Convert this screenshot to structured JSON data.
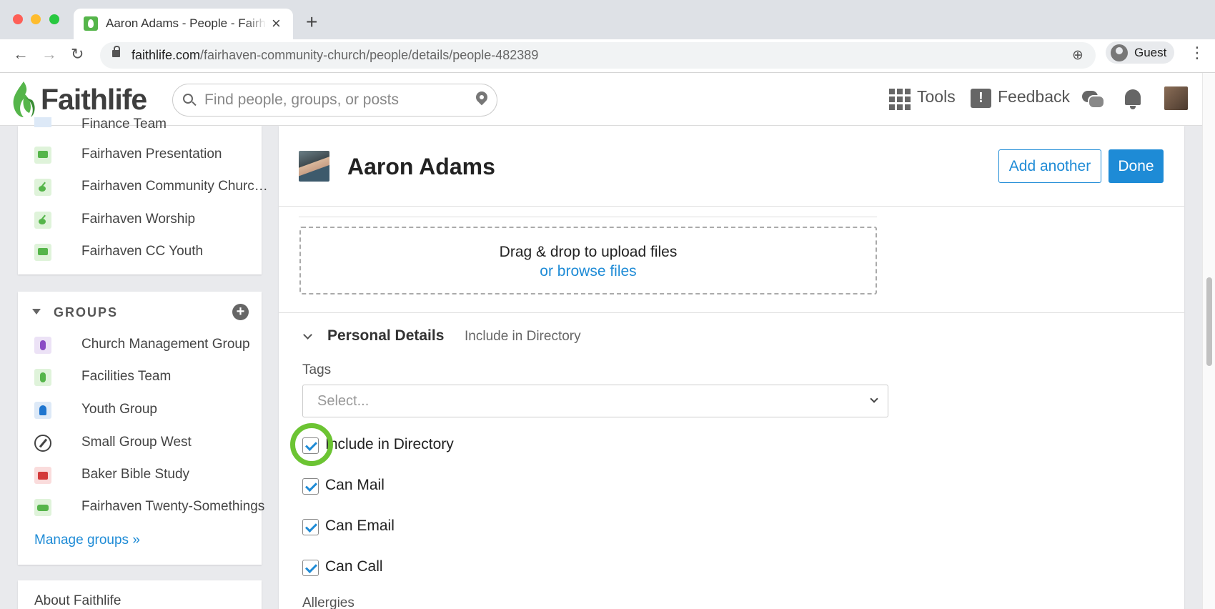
{
  "browser": {
    "tab_title": "Aaron Adams - People - Fairhaven",
    "new_tab_icon": "plus-icon",
    "url_domain": "faithlife.com",
    "url_path": "/fairhaven-community-church/people/details/people-482389",
    "profile_label": "Guest"
  },
  "header": {
    "logo_text": "Faithlife",
    "search_placeholder": "Find people, groups, or posts",
    "tools_label": "Tools",
    "feedback_label": "Feedback",
    "feedback_glyph": "!"
  },
  "sidebar": {
    "partial_item_label": "Finance Team",
    "top_items": [
      {
        "label": "Fairhaven Presentation",
        "icon": "chat-icon"
      },
      {
        "label": "Fairhaven Community Churc…",
        "icon": "guitar-icon"
      },
      {
        "label": "Fairhaven Worship",
        "icon": "guitar-icon"
      },
      {
        "label": "Fairhaven CC Youth",
        "icon": "chat-icon"
      }
    ],
    "groups_title": "GROUPS",
    "add_glyph": "+",
    "groups": [
      {
        "label": "Church Management Group",
        "icon": "people-icon"
      },
      {
        "label": "Facilities Team",
        "icon": "people-icon"
      },
      {
        "label": "Youth Group",
        "icon": "person-icon"
      },
      {
        "label": "Small Group West",
        "icon": "compass-icon"
      },
      {
        "label": "Baker Bible Study",
        "icon": "bible-icon"
      },
      {
        "label": "Fairhaven Twenty-Somethings",
        "icon": "couch-icon"
      }
    ],
    "manage_groups_link": "Manage groups »",
    "about_link": "About Faithlife"
  },
  "person": {
    "name": "Aaron Adams",
    "add_another_label": "Add another",
    "done_label": "Done"
  },
  "upload": {
    "text": "Drag & drop to upload files",
    "browse_link": "or browse files"
  },
  "personal_details": {
    "title": "Personal Details",
    "subtitle": "Include in Directory",
    "tags_label": "Tags",
    "tags_placeholder": "Select...",
    "checkboxes": [
      {
        "label": "Include in Directory",
        "checked": true
      },
      {
        "label": "Can Mail",
        "checked": true
      },
      {
        "label": "Can Email",
        "checked": true
      },
      {
        "label": "Can Call",
        "checked": true
      }
    ],
    "allergies_label": "Allergies"
  },
  "colors": {
    "accent": "#1e8bd6",
    "brand_green": "#55b54a",
    "highlight_ring": "#6cc433"
  }
}
